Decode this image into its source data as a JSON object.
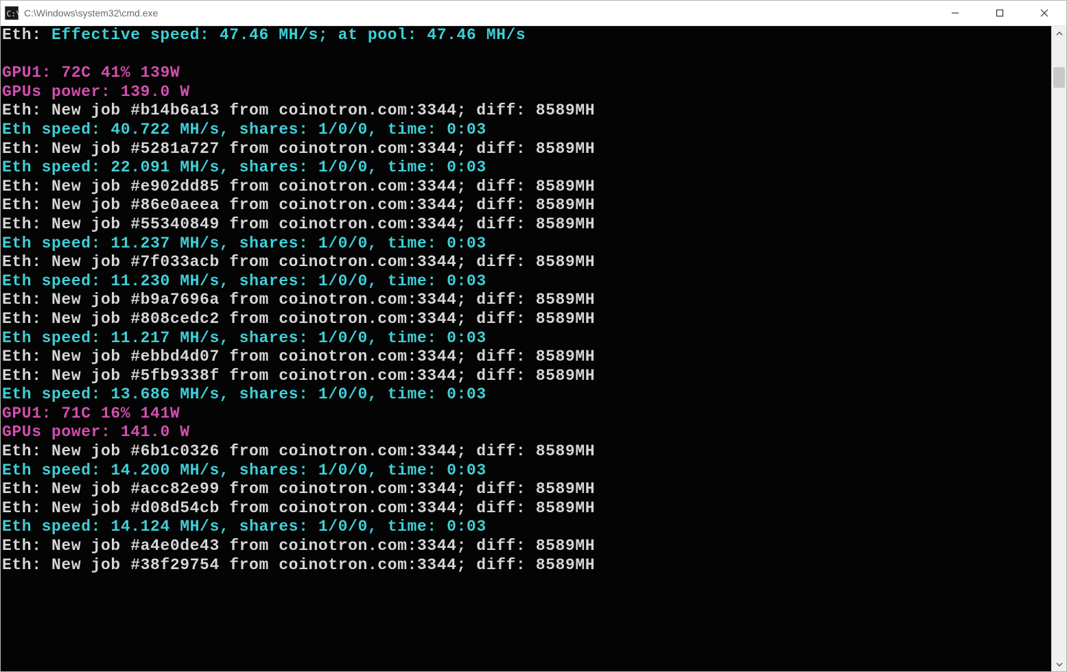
{
  "window": {
    "title": "C:\\Windows\\system32\\cmd.exe"
  },
  "terminal": {
    "lines": [
      {
        "kind": "effective",
        "label": "Eth:",
        "text": " Effective speed: 47.46 MH/s; at pool: 47.46 MH/s"
      },
      {
        "kind": "blank"
      },
      {
        "kind": "gpu",
        "label": "GPU1:",
        "text": " 72C 41% 139W"
      },
      {
        "kind": "power",
        "label": "GPUs power:",
        "text": " 139.0 W"
      },
      {
        "kind": "job",
        "label": "Eth:",
        "text": " New job #b14b6a13 from coinotron.com:3344; diff: 8589MH"
      },
      {
        "kind": "speed",
        "label": "Eth speed:",
        "text": " 40.722 MH/s, shares: 1/0/0, time: 0:03"
      },
      {
        "kind": "job",
        "label": "Eth:",
        "text": " New job #5281a727 from coinotron.com:3344; diff: 8589MH"
      },
      {
        "kind": "speed",
        "label": "Eth speed:",
        "text": " 22.091 MH/s, shares: 1/0/0, time: 0:03"
      },
      {
        "kind": "job",
        "label": "Eth:",
        "text": " New job #e902dd85 from coinotron.com:3344; diff: 8589MH"
      },
      {
        "kind": "job",
        "label": "Eth:",
        "text": " New job #86e0aeea from coinotron.com:3344; diff: 8589MH"
      },
      {
        "kind": "job",
        "label": "Eth:",
        "text": " New job #55340849 from coinotron.com:3344; diff: 8589MH"
      },
      {
        "kind": "speed",
        "label": "Eth speed:",
        "text": " 11.237 MH/s, shares: 1/0/0, time: 0:03"
      },
      {
        "kind": "job",
        "label": "Eth:",
        "text": " New job #7f033acb from coinotron.com:3344; diff: 8589MH"
      },
      {
        "kind": "speed",
        "label": "Eth speed:",
        "text": " 11.230 MH/s, shares: 1/0/0, time: 0:03"
      },
      {
        "kind": "job",
        "label": "Eth:",
        "text": " New job #b9a7696a from coinotron.com:3344; diff: 8589MH"
      },
      {
        "kind": "job",
        "label": "Eth:",
        "text": " New job #808cedc2 from coinotron.com:3344; diff: 8589MH"
      },
      {
        "kind": "speed",
        "label": "Eth speed:",
        "text": " 11.217 MH/s, shares: 1/0/0, time: 0:03"
      },
      {
        "kind": "job",
        "label": "Eth:",
        "text": " New job #ebbd4d07 from coinotron.com:3344; diff: 8589MH"
      },
      {
        "kind": "job",
        "label": "Eth:",
        "text": " New job #5fb9338f from coinotron.com:3344; diff: 8589MH"
      },
      {
        "kind": "speed",
        "label": "Eth speed:",
        "text": " 13.686 MH/s, shares: 1/0/0, time: 0:03"
      },
      {
        "kind": "gpu",
        "label": "GPU1:",
        "text": " 71C 16% 141W"
      },
      {
        "kind": "power",
        "label": "GPUs power:",
        "text": " 141.0 W"
      },
      {
        "kind": "job",
        "label": "Eth:",
        "text": " New job #6b1c0326 from coinotron.com:3344; diff: 8589MH"
      },
      {
        "kind": "speed",
        "label": "Eth speed:",
        "text": " 14.200 MH/s, shares: 1/0/0, time: 0:03"
      },
      {
        "kind": "job",
        "label": "Eth:",
        "text": " New job #acc82e99 from coinotron.com:3344; diff: 8589MH"
      },
      {
        "kind": "job",
        "label": "Eth:",
        "text": " New job #d08d54cb from coinotron.com:3344; diff: 8589MH"
      },
      {
        "kind": "speed",
        "label": "Eth speed:",
        "text": " 14.124 MH/s, shares: 1/0/0, time: 0:03"
      },
      {
        "kind": "job",
        "label": "Eth:",
        "text": " New job #a4e0de43 from coinotron.com:3344; diff: 8589MH"
      },
      {
        "kind": "job",
        "label": "Eth:",
        "text": " New job #38f29754 from coinotron.com:3344; diff: 8589MH"
      }
    ]
  }
}
